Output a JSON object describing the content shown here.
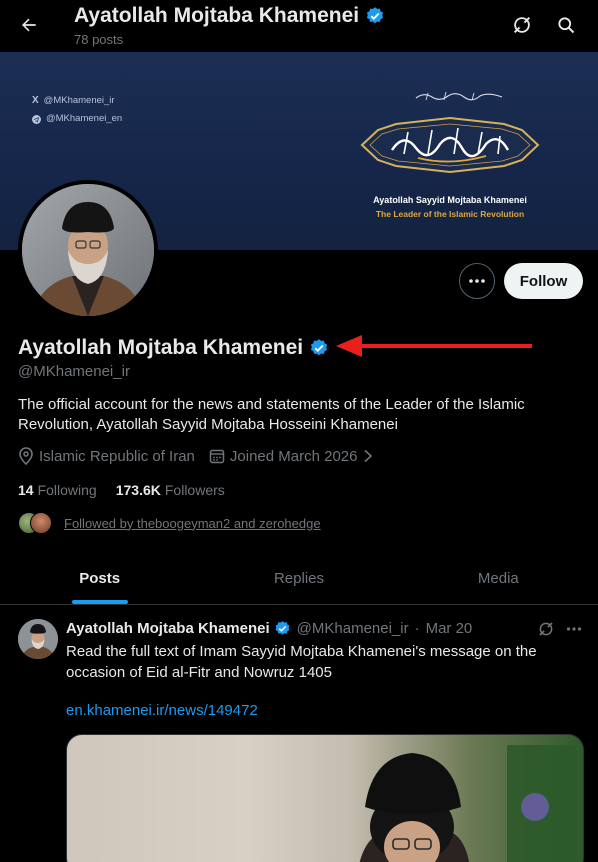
{
  "header": {
    "title": "Ayatollah Mojtaba Khamenei",
    "post_count": "78 posts"
  },
  "banner": {
    "x_handle": "@MKhamenei_ir",
    "telegram_handle": "@MKhamenei_en",
    "name_en": "Ayatollah Sayyid Mojtaba Khamenei",
    "role_en": "The Leader of the Islamic Revolution"
  },
  "profile": {
    "display_name": "Ayatollah Mojtaba Khamenei",
    "handle": "@MKhamenei_ir",
    "bio": "The official account for the news and statements of the Leader of the Islamic Revolution, Ayatollah Sayyid Mojtaba Hosseini Khamenei",
    "location": "Islamic Republic of Iran",
    "joined": "Joined March 2026",
    "following_count": "14",
    "following_label": "Following",
    "followers_count": "173.6K",
    "followers_label": "Followers",
    "followed_by": "Followed by theboogeyman2 and zerohedge"
  },
  "actions": {
    "follow_label": "Follow"
  },
  "tabs": [
    {
      "label": "Posts",
      "active": true
    },
    {
      "label": "Replies",
      "active": false
    },
    {
      "label": "Media",
      "active": false
    }
  ],
  "tweet": {
    "name": "Ayatollah Mojtaba Khamenei",
    "handle": "@MKhamenei_ir",
    "separator": "·",
    "date": "Mar 20",
    "text": "Read the full text of Imam Sayyid Mojtaba Khamenei's message on the occasion of Eid al-Fitr and Nowruz 1405",
    "link": "en.khamenei.ir/news/149472"
  },
  "colors": {
    "verified": "#1d9bf0",
    "link": "#1d9bf0",
    "arrow": "#e8201c",
    "background": "#000000"
  }
}
